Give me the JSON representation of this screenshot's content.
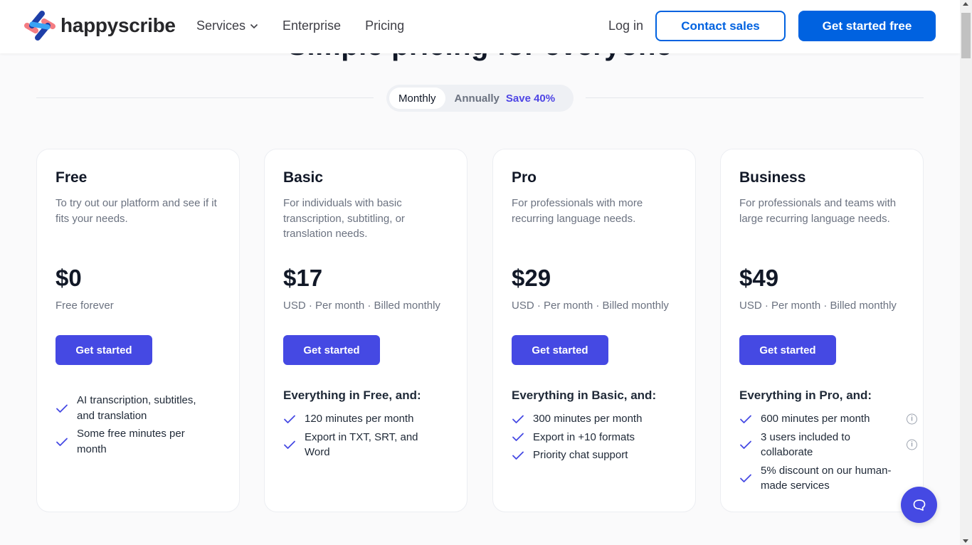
{
  "header": {
    "logo_text": "happyscribe",
    "nav": [
      {
        "label": "Services",
        "has_dropdown": true
      },
      {
        "label": "Enterprise"
      },
      {
        "label": "Pricing"
      }
    ],
    "login_label": "Log in",
    "contact_label": "Contact sales",
    "get_started_label": "Get started free"
  },
  "heading_partial": "Simple pricing for everyone",
  "billing_toggle": {
    "monthly_label": "Monthly",
    "annually_label": "Annually",
    "save_label": "Save 40%",
    "selected": "Monthly"
  },
  "plans": [
    {
      "name": "Free",
      "description": "To try out our platform and see if it fits your needs.",
      "price": "$0",
      "billing": "Free forever",
      "button": "Get started",
      "subheading": "",
      "features": [
        {
          "text": "AI transcription, subtitles, and translation",
          "info": false
        },
        {
          "text": "Some free minutes per month",
          "info": false
        }
      ]
    },
    {
      "name": "Basic",
      "description": "For individuals with basic transcription, subtitling, or translation needs.",
      "price": "$17",
      "billing": "USD · Per month · Billed monthly",
      "button": "Get started",
      "subheading": "Everything in Free, and:",
      "features": [
        {
          "text": "120 minutes per month",
          "info": false
        },
        {
          "text": "Export in TXT, SRT, and Word",
          "info": false
        }
      ]
    },
    {
      "name": "Pro",
      "description": "For professionals with more recurring language needs.",
      "price": "$29",
      "billing": "USD · Per month · Billed monthly",
      "button": "Get started",
      "subheading": "Everything in Basic, and:",
      "features": [
        {
          "text": "300 minutes per month",
          "info": false
        },
        {
          "text": "Export in +10 formats",
          "info": false
        },
        {
          "text": "Priority chat support",
          "info": false
        }
      ]
    },
    {
      "name": "Business",
      "description": "For professionals and teams with large recurring language needs.",
      "price": "$49",
      "billing": "USD · Per month · Billed monthly",
      "button": "Get started",
      "subheading": "Everything in Pro, and:",
      "features": [
        {
          "text": "600 minutes per month",
          "info": true
        },
        {
          "text": "3 users included to collaborate",
          "info": true
        },
        {
          "text": "5% discount on our human-made services",
          "info": false
        }
      ]
    }
  ],
  "colors": {
    "brand_blue": "#0062e0",
    "accent_indigo": "#4549e3",
    "save_text": "#4f46e5"
  },
  "icons": {
    "check": "check-icon",
    "info": "info-icon",
    "chat": "chat-bubble-icon",
    "chevron": "chevron-down-icon"
  }
}
